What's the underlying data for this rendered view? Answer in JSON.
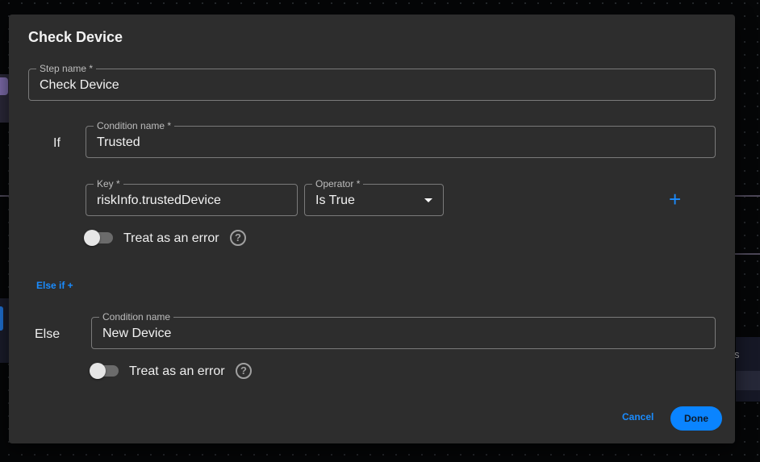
{
  "dialog": {
    "title": "Check Device",
    "step_name": {
      "label": "Step name *",
      "value": "Check Device"
    },
    "if_section": {
      "label": "If",
      "condition_name": {
        "label": "Condition name *",
        "value": "Trusted"
      },
      "key": {
        "label": "Key *",
        "value": "riskInfo.trustedDevice"
      },
      "operator": {
        "label": "Operator *",
        "value": "Is True"
      },
      "add_icon": "plus-icon",
      "treat_as_error": {
        "label": "Treat as an error",
        "checked": false
      },
      "help_icon": "help-circle-icon"
    },
    "else_if_link": "Else if +",
    "else_section": {
      "label": "Else",
      "condition_name": {
        "label": "Condition name",
        "value": "New Device"
      },
      "treat_as_error": {
        "label": "Treat as an error",
        "checked": false
      },
      "help_icon": "help-circle-icon"
    },
    "footer": {
      "cancel_label": "Cancel",
      "done_label": "Done"
    }
  },
  "background": {
    "right_node_text": "s"
  },
  "colors": {
    "accent": "#0a84ff",
    "dialog_bg": "#2d2d2d",
    "page_bg": "#050607"
  }
}
